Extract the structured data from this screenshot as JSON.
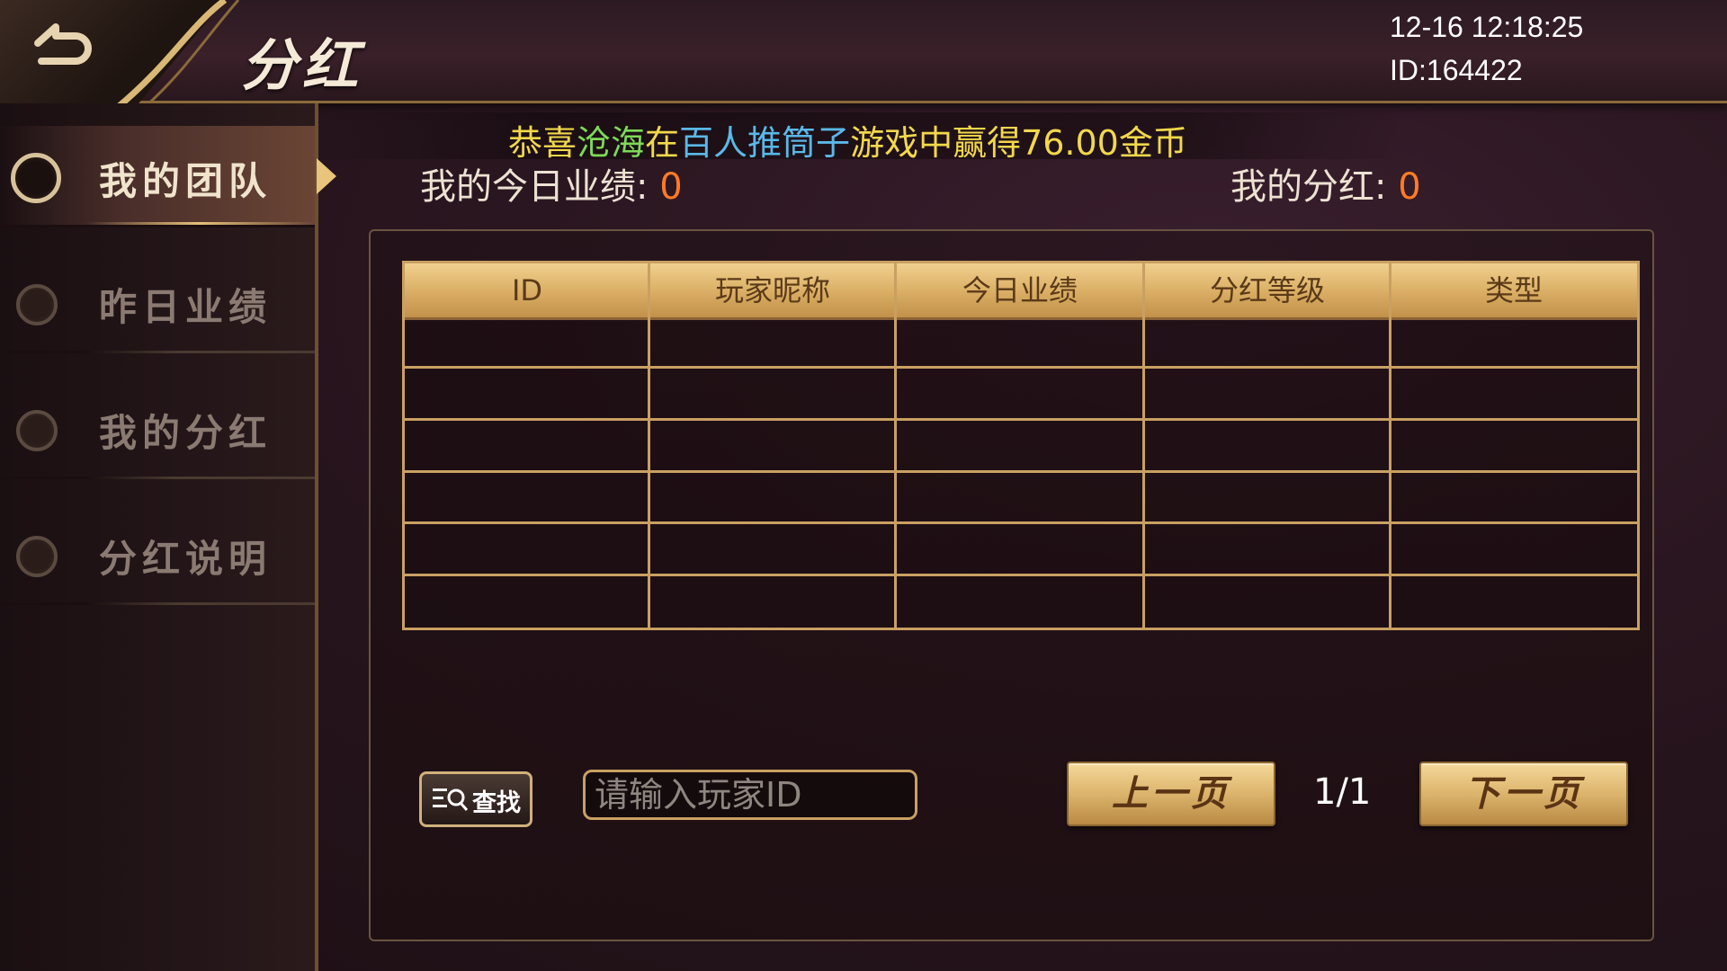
{
  "header": {
    "title": "分红",
    "datetime": "12-16 12:18:25",
    "user_id": "ID:164422"
  },
  "sidebar": {
    "items": [
      {
        "label": "我的团队",
        "active": true
      },
      {
        "label": "昨日业绩",
        "active": false
      },
      {
        "label": "我的分红",
        "active": false
      },
      {
        "label": "分红说明",
        "active": false
      }
    ]
  },
  "marquee": {
    "parts": [
      "恭喜",
      "沧海",
      "在",
      "百人推筒子",
      "游戏中赢得76.00金币"
    ]
  },
  "stats": {
    "today_performance_label": "我的今日业绩: ",
    "today_performance_value": "0",
    "dividend_label": "我的分红: ",
    "dividend_value": "0"
  },
  "table": {
    "columns": [
      "ID",
      "玩家昵称",
      "今日业绩",
      "分红等级",
      "类型"
    ],
    "rows": []
  },
  "controls": {
    "search_label": "查找",
    "input_placeholder": "请输入玩家ID",
    "prev_label": "上一页",
    "next_label": "下一页",
    "page_indicator": "1/1"
  },
  "colors": {
    "accent_gold": "#c9a063",
    "value_orange": "#ff7b24",
    "marquee_yellow": "#f2d84a",
    "marquee_green": "#7ed957",
    "marquee_blue": "#5ab8e8"
  }
}
